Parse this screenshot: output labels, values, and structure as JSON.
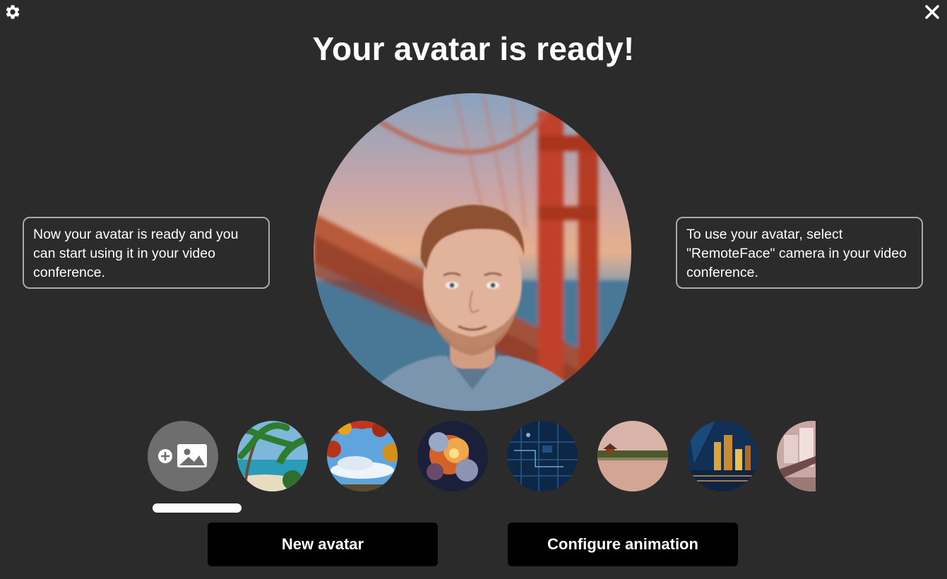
{
  "title": "Your avatar is ready!",
  "info_left": "Now your avatar is ready and you can start using it in your video conference.",
  "info_right": "To use your avatar, select \"RemoteFace\" camera in your video conference.",
  "icons": {
    "settings": "gear-icon",
    "close": "close-icon",
    "add_background": "add-image-icon"
  },
  "backgrounds": [
    {
      "name": "tropical-beach"
    },
    {
      "name": "autumn-leaves-sky"
    },
    {
      "name": "fire-explosion"
    },
    {
      "name": "digital-circuit"
    },
    {
      "name": "palace-lake-sunset"
    },
    {
      "name": "city-night-bridge"
    },
    {
      "name": "city-street-partial"
    }
  ],
  "selected_background": "golden-gate-bridge",
  "buttons": {
    "new_avatar": "New avatar",
    "configure_animation": "Configure animation"
  },
  "colors": {
    "background": "#2b2b2b",
    "button": "#000000",
    "box_border": "#a9a9a9",
    "accent": "#ffffff"
  }
}
